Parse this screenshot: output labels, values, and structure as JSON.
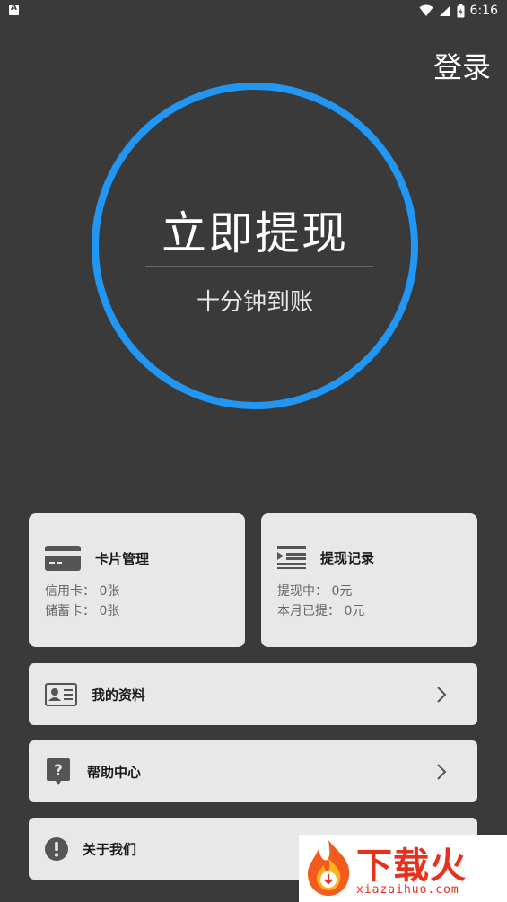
{
  "status_bar": {
    "time": "6:16",
    "icons": [
      "notification-a-icon",
      "wifi-icon",
      "signal-icon",
      "battery-icon"
    ]
  },
  "header": {
    "login_label": "登录"
  },
  "withdraw": {
    "title": "立即提现",
    "subtitle": "十分钟到账",
    "ring_color": "#2196f3"
  },
  "cards": {
    "card_management": {
      "title": "卡片管理",
      "icon": "credit-card-icon",
      "credit_label": "信用卡：",
      "credit_value": "0张",
      "debit_label": "储蓄卡：",
      "debit_value": "0张"
    },
    "withdraw_records": {
      "title": "提现记录",
      "icon": "list-icon",
      "pending_label": "提现中：",
      "pending_value": "0元",
      "month_label": "本月已提：",
      "month_value": "0元"
    }
  },
  "menu": {
    "profile": {
      "label": "我的资料",
      "icon": "id-card-icon"
    },
    "help": {
      "label": "帮助中心",
      "icon": "help-bubble-icon"
    },
    "about": {
      "label": "关于我们",
      "icon": "info-exclamation-icon"
    }
  },
  "watermark": {
    "brand": "下载火",
    "domain": "xiazaihuo.com",
    "accent": "#e8301c"
  },
  "colors": {
    "background": "#3a3a3a",
    "card": "#e8e8e8",
    "accent": "#2196f3"
  }
}
